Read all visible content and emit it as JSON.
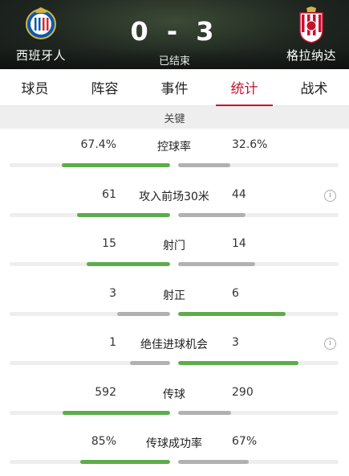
{
  "match": {
    "home_team": "西班牙人",
    "away_team": "格拉纳达",
    "score": "0 - 3",
    "status": "已结束",
    "home_crest_icon": "espanyol-crest-icon",
    "away_crest_icon": "granada-crest-icon"
  },
  "tabs": [
    {
      "label": "球员",
      "active": false
    },
    {
      "label": "阵容",
      "active": false
    },
    {
      "label": "事件",
      "active": false
    },
    {
      "label": "统计",
      "active": true
    },
    {
      "label": "战术",
      "active": false
    }
  ],
  "section": {
    "title": "关键"
  },
  "colors": {
    "accent": "#c8102e",
    "leading_bar": "#5cad4a",
    "trailing_bar": "#b1b1b1",
    "track": "#eeeeee"
  },
  "stats": [
    {
      "name": "控球率",
      "home": "67.4%",
      "away": "32.6%",
      "home_share": 0.674,
      "away_share": 0.326,
      "leader": "home",
      "info": false
    },
    {
      "name": "攻入前场30米",
      "home": "61",
      "away": "44",
      "home_share": 0.58,
      "away_share": 0.42,
      "leader": "home",
      "info": true
    },
    {
      "name": "射门",
      "home": "15",
      "away": "14",
      "home_share": 0.52,
      "away_share": 0.48,
      "leader": "home",
      "info": false
    },
    {
      "name": "射正",
      "home": "3",
      "away": "6",
      "home_share": 0.33,
      "away_share": 0.67,
      "leader": "away",
      "info": false
    },
    {
      "name": "绝佳进球机会",
      "home": "1",
      "away": "3",
      "home_share": 0.25,
      "away_share": 0.75,
      "leader": "away",
      "info": true
    },
    {
      "name": "传球",
      "home": "592",
      "away": "290",
      "home_share": 0.67,
      "away_share": 0.33,
      "leader": "home",
      "info": false
    },
    {
      "name": "传球成功率",
      "home": "85%",
      "away": "67%",
      "home_share": 0.56,
      "away_share": 0.44,
      "leader": "home",
      "info": false
    }
  ]
}
